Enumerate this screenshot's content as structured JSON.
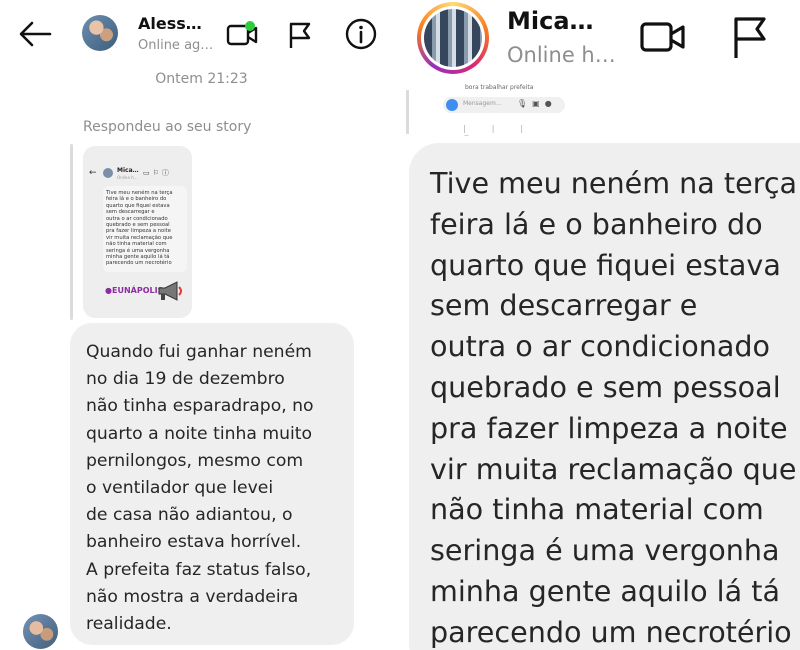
{
  "left_panel": {
    "contact_name": "Aless…",
    "contact_status": "Online ag…",
    "timestamp": "Ontem 21:23",
    "replied_label": "Respondeu ao seu story",
    "story_preview": {
      "header_name": "Mica…",
      "header_status": "Online h…",
      "text": "Tive meu neném na terça\nfeira lá e o banheiro do\nquarto que fiquei estava\nsem descarregar e\noutra o ar condicionado\nquebrado e sem pessoal\npra fazer limpeza a noite\nvir muita reclamação que\nnão tinha material com\nseringa é uma vergonha\nminha gente aquilo lá tá\nparecendo um necrotério",
      "brand": "●EUNÁPOLIS"
    },
    "message": "Quando fui ganhar neném\nno dia 19 de dezembro\nnão tinha esparadrapo, no\nquarto a noite tinha muito\npernilongos, mesmo com\no ventilador que levei\nde casa não adiantou, o\nbanheiro estava horrível.\nA prefeita faz status falso,\nnão mostra a verdadeira\nrealidade."
  },
  "right_panel": {
    "contact_name": "Mica…",
    "contact_status": "Online h…",
    "thumbnail": {
      "prev_message": "bora trabalhar prefeita",
      "input_placeholder": "Mensagem…"
    },
    "message": "Tive meu neném na terça\nfeira lá e o banheiro do\nquarto que fiquei estava\nsem descarregar e\noutra o ar condicionado\nquebrado e sem pessoal\npra fazer limpeza a noite\nvir muita reclamação que\nnão tinha material com\nseringa é uma vergonha\nminha gente aquilo lá tá\nparecendo um necrotério"
  },
  "icons": [
    "back-arrow-icon",
    "video-call-icon",
    "flag-icon",
    "info-icon",
    "megaphone-icon",
    "camera-icon",
    "microphone-icon",
    "image-icon",
    "plus-icon"
  ],
  "colors": {
    "bubble": "#efefef",
    "muted_text": "#8e8e8e",
    "online_dot": "#2ecc40",
    "brand_purple": "#8b2fa0"
  }
}
